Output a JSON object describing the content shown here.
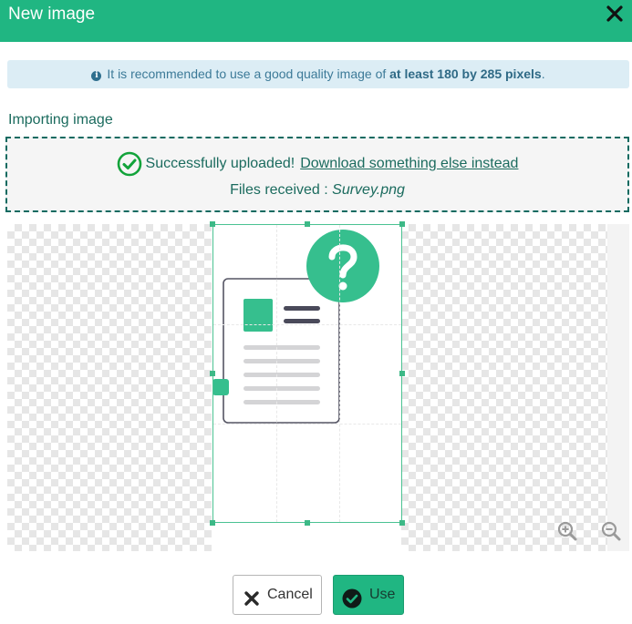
{
  "dialog": {
    "title": "New image",
    "close_icon": "close-icon"
  },
  "info": {
    "icon": "info-icon",
    "text_prefix": "It is recommended to use a good quality image of",
    "text_bold": "at least 180 by 285 pixels",
    "text_suffix": "."
  },
  "importing": {
    "label": "Importing image"
  },
  "upload": {
    "icon": "check-circle-icon",
    "success_text": "Successfully uploaded!",
    "alt_link": "Download something else instead",
    "files_label": "Files received : ",
    "file_name": "Survey.png"
  },
  "zoom": {
    "zoom_in_icon": "zoom-in-icon",
    "zoom_out_icon": "zoom-out-icon"
  },
  "footer": {
    "cancel_label": "Cancel",
    "use_label": "Use"
  },
  "colors": {
    "accent": "#20b682",
    "info_bg": "#dcedf5",
    "info_text": "#3c7a98",
    "teal_text": "#1b6b5e"
  }
}
